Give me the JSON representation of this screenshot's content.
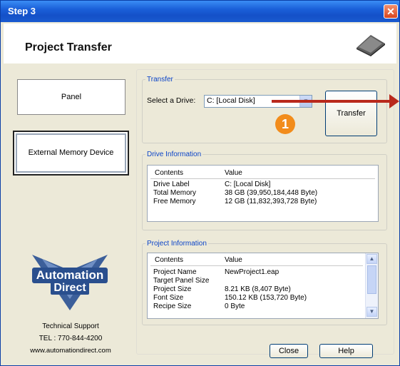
{
  "window": {
    "title": "Step 3"
  },
  "header": {
    "title": "Project Transfer",
    "icon": "device-icon"
  },
  "left": {
    "panel_label": "Panel",
    "external_label": "External Memory Device",
    "logo_line1": "Automation",
    "logo_line2": "Direct",
    "support_title": "Technical Support",
    "support_tel": "TEL : 770-844-4200",
    "support_web": "www.automationdirect.com"
  },
  "transfer": {
    "legend": "Transfer",
    "select_label": "Select a Drive:",
    "drive_value": "C: [Local Disk]",
    "transfer_button": "Transfer",
    "step_number": "1"
  },
  "drive_info": {
    "legend": "Drive Information",
    "columns": [
      "Contents",
      "Value"
    ],
    "rows": [
      [
        "Drive Label",
        "C: [Local Disk]"
      ],
      [
        "Total Memory",
        "38 GB (39,950,184,448 Byte)"
      ],
      [
        "Free Memory",
        "12 GB (11,832,393,728 Byte)"
      ]
    ]
  },
  "project_info": {
    "legend": "Project Information",
    "columns": [
      "Contents",
      "Value"
    ],
    "rows": [
      [
        "Project Name",
        "NewProject1.eap"
      ],
      [
        "Target Panel Size",
        ""
      ],
      [
        "Project Size",
        "8.21 KB (8,407 Byte)"
      ],
      [
        "Font Size",
        "150.12 KB (153,720 Byte)"
      ],
      [
        "Recipe Size",
        "0 Byte"
      ]
    ]
  },
  "footer": {
    "close": "Close",
    "help": "Help"
  },
  "colors": {
    "title_bar": "#1a5fd8",
    "accent_arrow": "#b9291c",
    "badge": "#f28c1b",
    "legend": "#0b44c8"
  }
}
